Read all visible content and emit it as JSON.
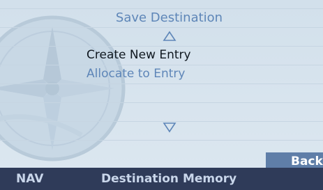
{
  "menu": {
    "title": "Save Destination",
    "items": [
      {
        "label": "Create New Entry",
        "selected": true
      },
      {
        "label": "Allocate to Entry",
        "selected": false
      }
    ],
    "scroll_up_icon": "triangle-up-outline",
    "scroll_down_icon": "triangle-down-outline"
  },
  "actions": {
    "back_label": "Back"
  },
  "status_bar": {
    "mode": "NAV",
    "screen_title": "Destination Memory"
  },
  "colors": {
    "background": "#d4e1ec",
    "accent_text": "#5e86b8",
    "selected_text": "#101820",
    "button": "#5f7ea8",
    "status_bar": "#2f3b59"
  }
}
